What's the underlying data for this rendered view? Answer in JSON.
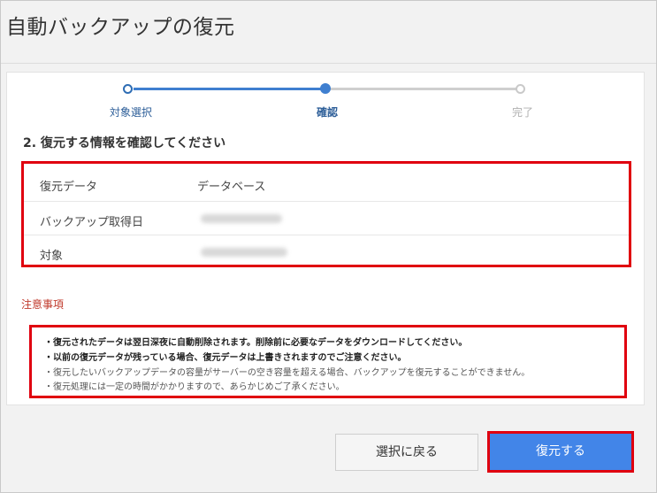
{
  "window": {
    "title": "自動バックアップの復元"
  },
  "stepper": {
    "steps": [
      {
        "label": "対象選択",
        "state": "done"
      },
      {
        "label": "確認",
        "state": "current"
      },
      {
        "label": "完了",
        "state": "pending"
      }
    ]
  },
  "confirm": {
    "heading": "2. 復元する情報を確認してください",
    "rows": [
      {
        "label": "復元データ",
        "value": "データベース"
      },
      {
        "label": "バックアップ取得日",
        "value": ""
      },
      {
        "label": "対象",
        "value": ""
      }
    ]
  },
  "notes": {
    "heading": "注意事項",
    "items": [
      "・復元されたデータは翌日深夜に自動削除されます。削除前に必要なデータをダウンロードしてください。",
      "・以前の復元データが残っている場合、復元データは上書きされますのでご注意ください。",
      "・復元したいバックアップデータの容量がサーバーの空き容量を超える場合、バックアップを復元することができません。",
      "・復元処理には一定の時間がかかりますので、あらかじめご了承ください。"
    ]
  },
  "buttons": {
    "back_label": "選択に戻る",
    "restore_label": "復元する"
  },
  "colors": {
    "accent": "#4285e8",
    "highlight_border": "#e0000f",
    "notes_heading": "#c0392b"
  }
}
